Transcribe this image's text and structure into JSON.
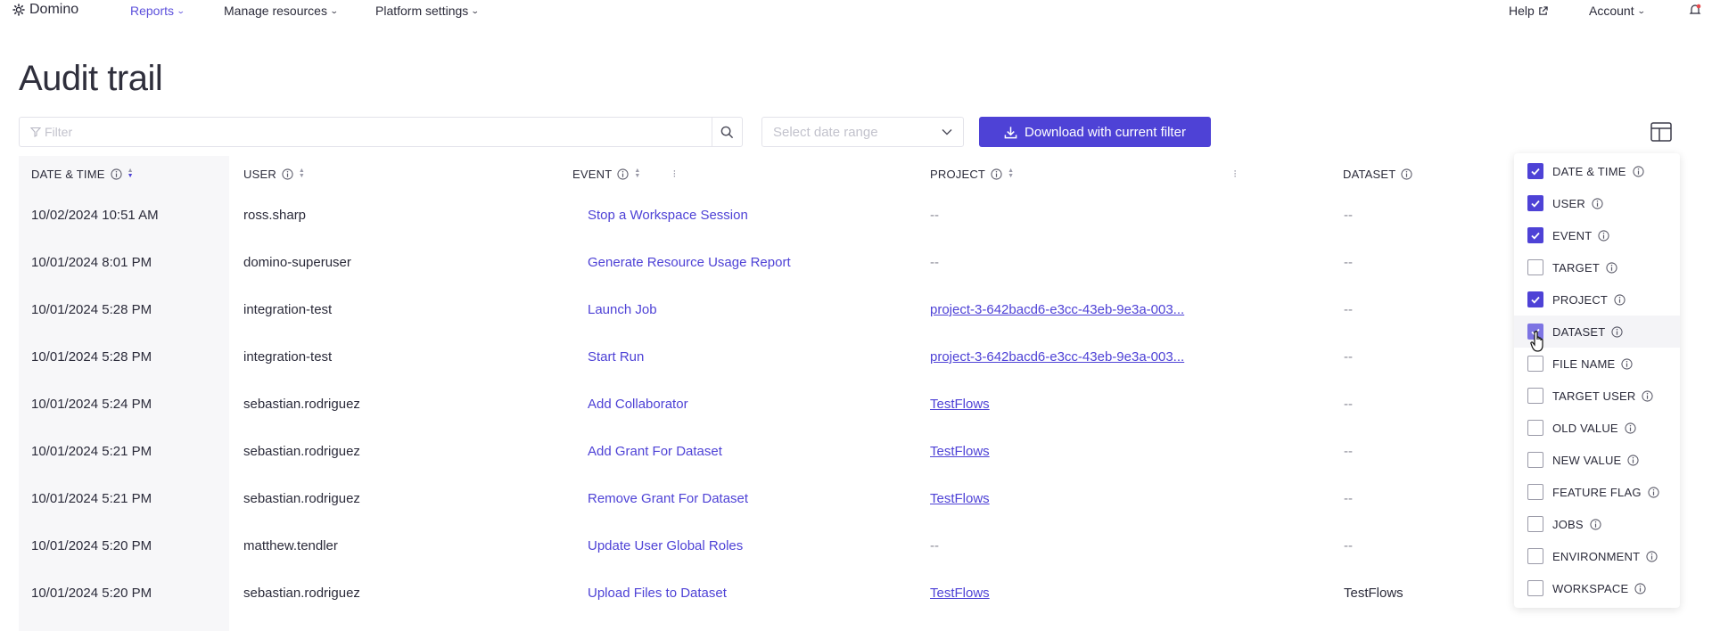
{
  "nav": {
    "brand": "Domino",
    "items": [
      {
        "label": "Reports",
        "active": true
      },
      {
        "label": "Manage resources",
        "active": false
      },
      {
        "label": "Platform settings",
        "active": false
      }
    ],
    "help": "Help",
    "account": "Account"
  },
  "page": {
    "title": "Audit trail"
  },
  "toolbar": {
    "filter_placeholder": "Filter",
    "date_placeholder": "Select date range",
    "download_label": "Download with current filter"
  },
  "table": {
    "headers": {
      "datetime": "DATE & TIME",
      "user": "USER",
      "event": "EVENT",
      "project": "PROJECT",
      "dataset": "DATASET"
    },
    "rows": [
      {
        "datetime": "10/02/2024 10:51 AM",
        "user": "ross.sharp",
        "event": "Stop a Workspace Session",
        "project": "--",
        "dataset": "--"
      },
      {
        "datetime": "10/01/2024 8:01 PM",
        "user": "domino-superuser",
        "event": "Generate Resource Usage Report",
        "project": "--",
        "dataset": "--"
      },
      {
        "datetime": "10/01/2024 5:28 PM",
        "user": "integration-test",
        "event": "Launch Job",
        "project": "project-3-642bacd6-e3cc-43eb-9e3a-003...",
        "dataset": "--"
      },
      {
        "datetime": "10/01/2024 5:28 PM",
        "user": "integration-test",
        "event": "Start Run",
        "project": "project-3-642bacd6-e3cc-43eb-9e3a-003...",
        "dataset": "--"
      },
      {
        "datetime": "10/01/2024 5:24 PM",
        "user": "sebastian.rodriguez",
        "event": "Add Collaborator",
        "project": "TestFlows",
        "dataset": "--"
      },
      {
        "datetime": "10/01/2024 5:21 PM",
        "user": "sebastian.rodriguez",
        "event": "Add Grant For Dataset",
        "project": "TestFlows",
        "dataset": "--"
      },
      {
        "datetime": "10/01/2024 5:21 PM",
        "user": "sebastian.rodriguez",
        "event": "Remove Grant For Dataset",
        "project": "TestFlows",
        "dataset": "--"
      },
      {
        "datetime": "10/01/2024 5:20 PM",
        "user": "matthew.tendler",
        "event": "Update User Global Roles",
        "project": "--",
        "dataset": "--"
      },
      {
        "datetime": "10/01/2024 5:20 PM",
        "user": "sebastian.rodriguez",
        "event": "Upload Files to Dataset",
        "project": "TestFlows",
        "dataset": "TestFlows"
      }
    ]
  },
  "column_picker": {
    "options": [
      {
        "label": "DATE & TIME",
        "checked": true
      },
      {
        "label": "USER",
        "checked": true
      },
      {
        "label": "EVENT",
        "checked": true
      },
      {
        "label": "TARGET",
        "checked": false
      },
      {
        "label": "PROJECT",
        "checked": true
      },
      {
        "label": "DATASET",
        "checked": true
      },
      {
        "label": "FILE NAME",
        "checked": false
      },
      {
        "label": "TARGET USER",
        "checked": false
      },
      {
        "label": "OLD VALUE",
        "checked": false
      },
      {
        "label": "NEW VALUE",
        "checked": false
      },
      {
        "label": "FEATURE FLAG",
        "checked": false
      },
      {
        "label": "JOBS",
        "checked": false
      },
      {
        "label": "ENVIRONMENT",
        "checked": false
      },
      {
        "label": "WORKSPACE",
        "checked": false
      }
    ]
  },
  "colors": {
    "accent": "#4e42d6",
    "text": "#2b2b3a",
    "muted": "#8a8a96"
  },
  "icons": {
    "brand": "gear-icon",
    "help_external": "external-link-icon",
    "notifications": "bell-icon",
    "filter": "funnel-icon",
    "search": "search-icon",
    "date_dropdown": "chevron-down-icon",
    "download": "download-icon",
    "columns": "layout-icon",
    "info": "info-icon"
  }
}
